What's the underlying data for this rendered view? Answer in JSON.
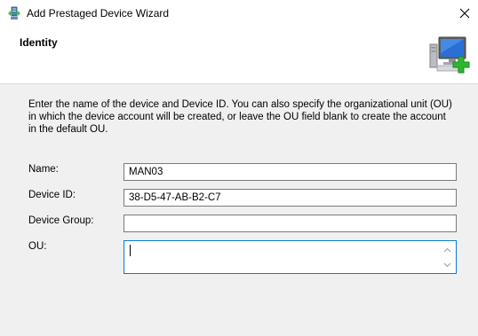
{
  "window": {
    "title": "Add Prestaged Device Wizard"
  },
  "header": {
    "title": "Identity",
    "icon": "computer-add-icon"
  },
  "description": "Enter the name of the device and Device ID. You can also specify the organizational unit (OU) in which the device account will be created, or leave the OU field blank to create the account in the default OU.",
  "form": {
    "name_label": "Name:",
    "name_value": "MAN03",
    "device_id_label": "Device ID:",
    "device_id_value": "38-D5-47-AB-B2-C7",
    "device_group_label": "Device Group:",
    "device_group_value": "",
    "ou_label": "OU:",
    "ou_value": ""
  },
  "colors": {
    "accent_focus_border": "#0a7ad6",
    "icon_green": "#2fb52f",
    "window_bg": "#f0f0f0"
  }
}
